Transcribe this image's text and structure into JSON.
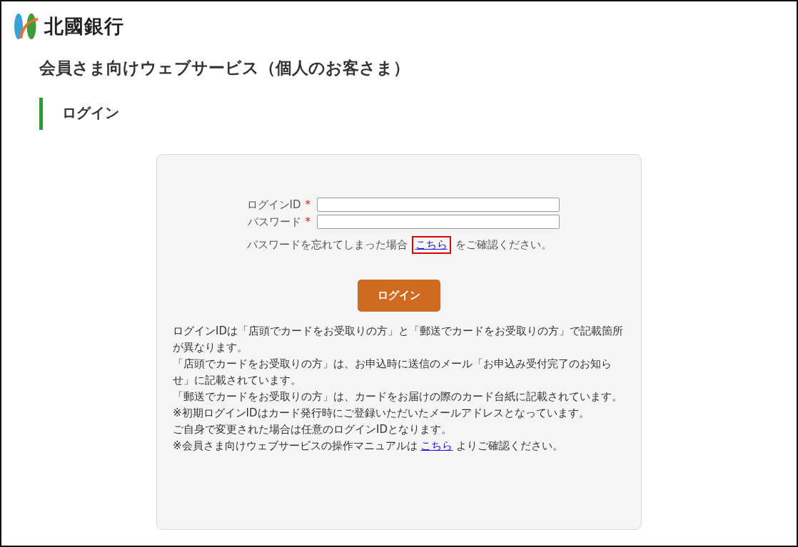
{
  "header": {
    "bank_name": "北國銀行"
  },
  "page_title": "会員さま向けウェブサービス（個人のお客さま）",
  "section_heading": "ログイン",
  "login_form": {
    "fields": [
      {
        "label": "ログインID",
        "required_mark": "*"
      },
      {
        "label": "パスワード",
        "required_mark": "*"
      }
    ],
    "forgot_password": {
      "before": "パスワードを忘れてしまった場合",
      "link": "こちら",
      "after": "をご確認ください。",
      "highlighted": true
    },
    "submit_button": "ログイン"
  },
  "notes": [
    {
      "text": "ログインIDは「店頭でカードをお受取りの方」と「郵送でカードをお受取りの方」で記載箇所が異なります。"
    },
    {
      "text": "「店頭でカードをお受取りの方」は、お申込時に送信のメール「お申込み受付完了のお知らせ」に記載されています。"
    },
    {
      "text": "「郵送でカードをお受取りの方」は、カードをお届けの際のカード台紙に記載されています。"
    },
    {
      "text": "※初期ログインIDはカード発行時にご登録いただいたメールアドレスとなっています。"
    },
    {
      "text": "ご自身で変更された場合は任意のログインIDとなります。"
    },
    {
      "text": "※会員さま向けウェブサービスの操作マニュアルは",
      "link": "こちら",
      "after": "よりご確認ください。"
    }
  ]
}
